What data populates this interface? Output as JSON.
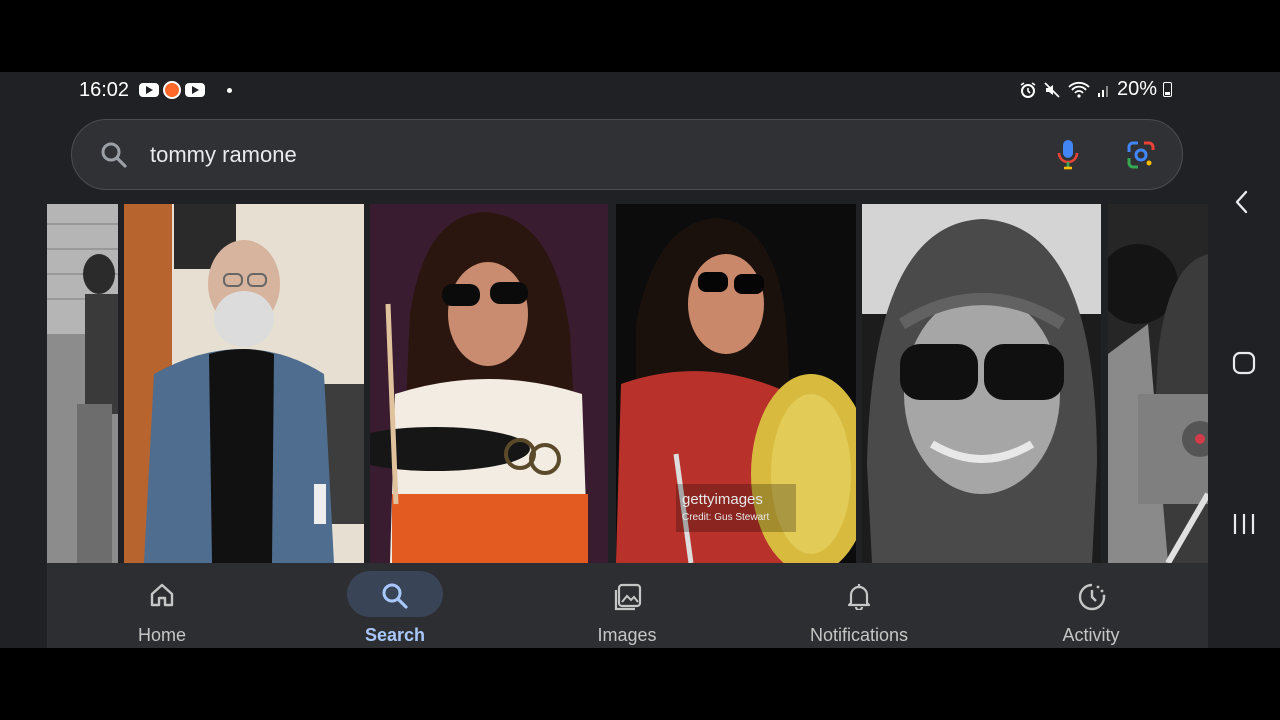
{
  "status_bar": {
    "time": "16:02",
    "battery": "20%",
    "notification_icons": [
      "youtube-icon",
      "app-icon",
      "youtube-icon"
    ],
    "system_icons": [
      "alarm-icon",
      "mute-icon",
      "wifi-icon",
      "signal-icon",
      "battery-icon"
    ]
  },
  "search": {
    "query": "tommy ramone",
    "icons": [
      "search-icon",
      "mic-icon",
      "lens-icon"
    ]
  },
  "images": {
    "watermark": "gettyimages",
    "credit": "Credit: Gus Stewart"
  },
  "bottom_nav": {
    "items": [
      {
        "label": "Home",
        "icon": "home-icon",
        "active": false
      },
      {
        "label": "Search",
        "icon": "search-icon",
        "active": true
      },
      {
        "label": "Images",
        "icon": "images-icon",
        "active": false
      },
      {
        "label": "Notifications",
        "icon": "bell-icon",
        "active": false
      },
      {
        "label": "Activity",
        "icon": "activity-icon",
        "active": false
      }
    ]
  },
  "system_nav": [
    "back-icon",
    "home-icon",
    "recents-icon"
  ],
  "colors": {
    "background": "#202124",
    "active_pill": "#394457",
    "active_label": "#a8c7fa"
  }
}
